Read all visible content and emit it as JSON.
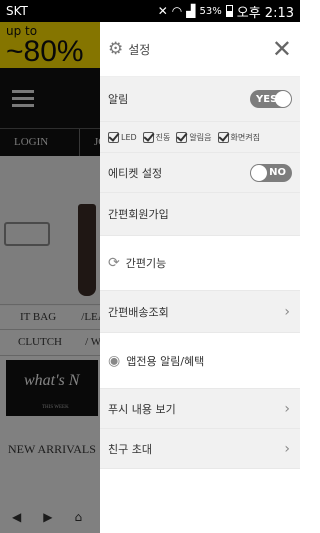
{
  "status_bar": {
    "carrier": "SKT",
    "battery": "53%",
    "time": "오후 2:13"
  },
  "background": {
    "banner": {
      "small_text": "up to",
      "sale_text": "~80%"
    },
    "login": "LOGIN",
    "join": "JOIN",
    "cat_row1": [
      "IT BAG",
      "/LEAT"
    ],
    "cat_row2": [
      "CLUTCH",
      "/ W"
    ],
    "whats_new": "what's N",
    "whats_sub": "THIS WEEK",
    "new_arrivals": "NEW ARRIVALS"
  },
  "drawer": {
    "header": {
      "title": "설정",
      "gear_icon": "gear-icon",
      "close_icon": "close-icon"
    },
    "alarm": {
      "label": "알림",
      "toggle_label": "YES"
    },
    "options": [
      {
        "label": "LED"
      },
      {
        "label": "진동"
      },
      {
        "label": "알림음"
      },
      {
        "label": "화면켜짐"
      }
    ],
    "etiquette": {
      "label": "에티켓 설정",
      "toggle_label": "NO"
    },
    "simple_signup": {
      "label": "간편회원가입"
    },
    "simple_function": {
      "label": "간편기능",
      "icon": "refresh-icon"
    },
    "shipping": {
      "label": "간편배송조회"
    },
    "app_benefits": {
      "label": "앱전용 알림/혜택",
      "icon": "target-icon"
    },
    "push_view": {
      "label": "푸시 내용 보기"
    },
    "invite": {
      "label": "친구 초대"
    }
  }
}
